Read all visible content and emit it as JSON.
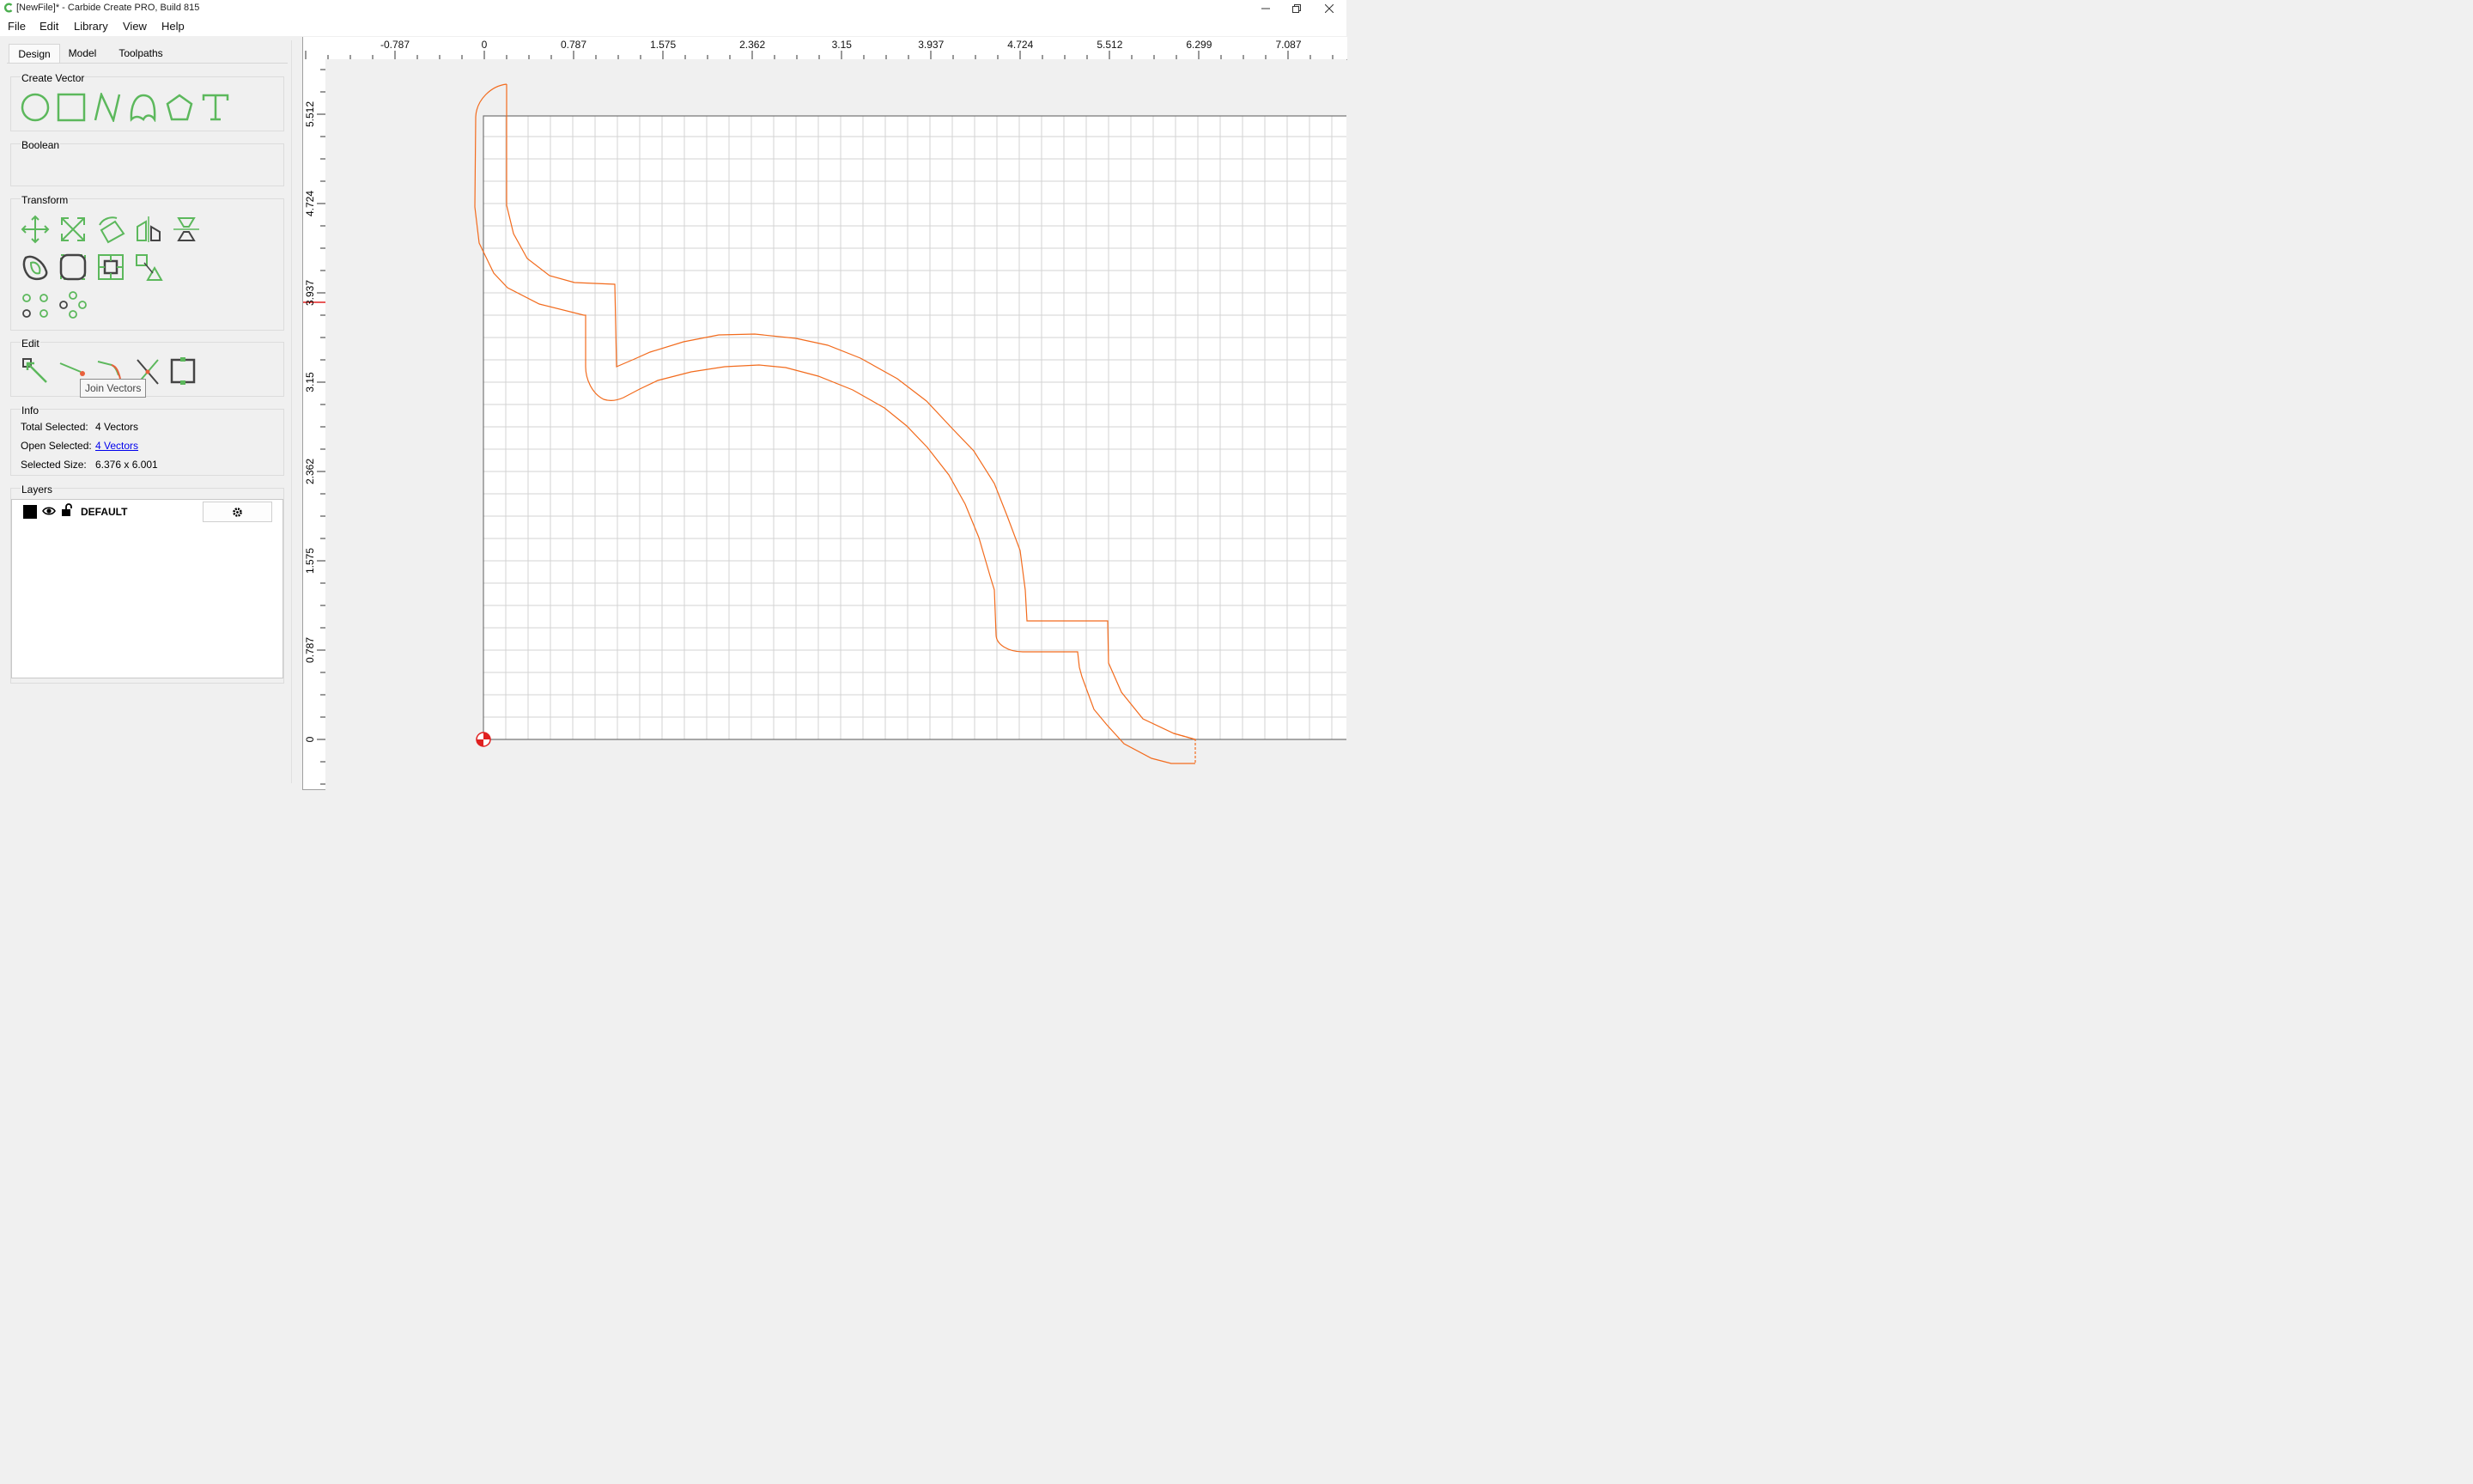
{
  "window": {
    "title": "[NewFile]* - Carbide Create PRO, Build 815",
    "controls": [
      "minimize-icon",
      "restore-icon",
      "close-icon"
    ]
  },
  "menu": [
    "File",
    "Edit",
    "Library",
    "View",
    "Help"
  ],
  "tabs": [
    "Design",
    "Model",
    "Toolpaths"
  ],
  "active_tab": "Design",
  "groups": {
    "create_vector": "Create Vector",
    "boolean": "Boolean",
    "transform": "Transform",
    "edit": "Edit",
    "info": "Info",
    "layers": "Layers"
  },
  "create_vector_tools": [
    "circle-icon",
    "rectangle-icon",
    "polyline-icon",
    "curve-icon",
    "polygon-icon",
    "text-icon"
  ],
  "transform_tools": [
    "move-icon",
    "scale-icon",
    "rotate-icon",
    "mirror-icon",
    "align-icon",
    "smooth-icon",
    "fillet-icon",
    "offset-icon",
    "array-icon",
    "circular-array-icon",
    "grid-array-icon"
  ],
  "edit_tools": [
    "node-edit-icon",
    "cut-vector-icon",
    "join-vectors-icon",
    "trim-icon",
    "bounding-box-icon"
  ],
  "tooltip": "Join Vectors",
  "info": {
    "total_selected_label": "Total Selected:",
    "total_selected_value": "4 Vectors",
    "open_selected_label": "Open Selected:",
    "open_selected_value": "4 Vectors",
    "selected_size_label": "Selected Size:",
    "selected_size_value": "6.376 x 6.001"
  },
  "layers": [
    {
      "name": "DEFAULT",
      "color": "#000000",
      "visible": true,
      "locked": false
    }
  ],
  "ruler_top_labels": [
    "-0.787",
    "0",
    "0.787",
    "1.575",
    "2.362",
    "3.15",
    "3.937",
    "4.724",
    "5.512",
    "6.299",
    "7.087"
  ],
  "ruler_left_labels": [
    "5.512",
    "4.724",
    "3.937",
    "3.15",
    "2.362",
    "1.575",
    "0.787",
    "0"
  ],
  "colors": {
    "vector": "#f26b1d",
    "tool_icon": "#5cb85c",
    "grid": "#d3d3d3",
    "origin": "#e02020"
  }
}
